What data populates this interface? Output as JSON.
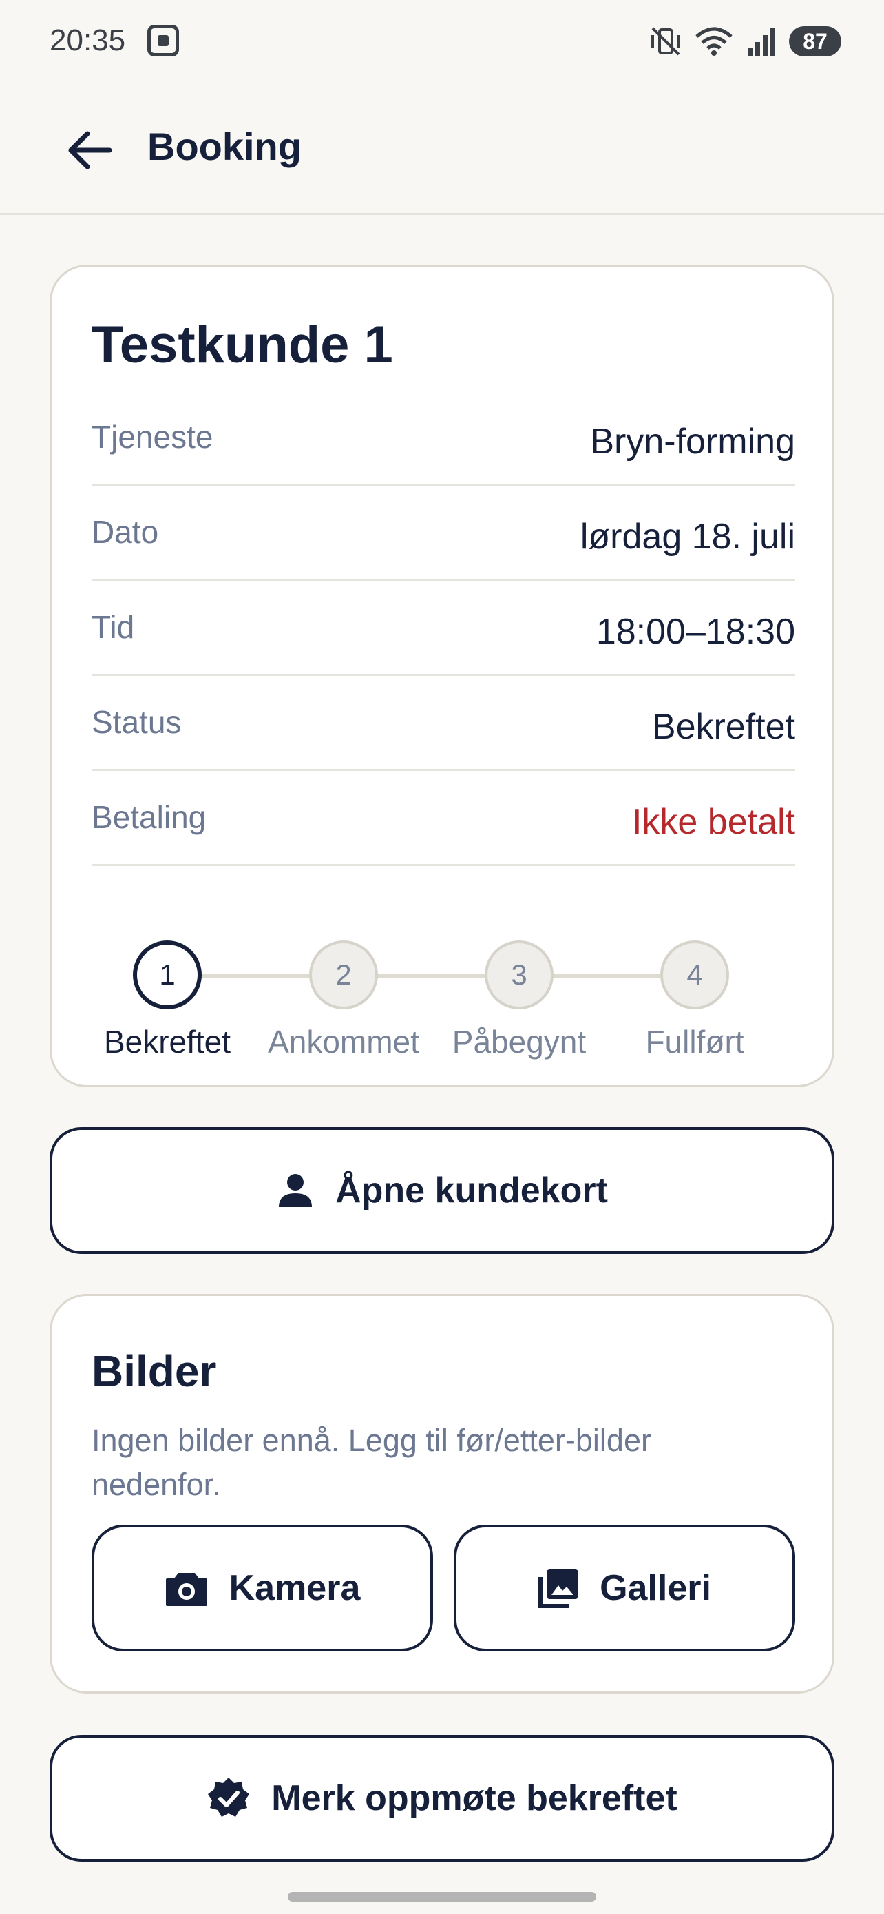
{
  "status_bar": {
    "time": "20:35",
    "battery": "87",
    "icons": [
      "screen-capture-icon",
      "mute-vibrate-icon",
      "wifi-icon",
      "signal-icon",
      "battery-icon"
    ]
  },
  "app_bar": {
    "title": "Booking",
    "back_icon": "arrow-left-icon"
  },
  "booking": {
    "customer_name": "Testkunde 1",
    "details": [
      {
        "label": "Tjeneste",
        "value": "Bryn-forming"
      },
      {
        "label": "Dato",
        "value": "lørdag 18. juli"
      },
      {
        "label": "Tid",
        "value": "18:00–18:30"
      },
      {
        "label": "Status",
        "value": "Bekreftet"
      },
      {
        "label": "Betaling",
        "value": "Ikke betalt"
      }
    ],
    "steps": [
      {
        "number": "1",
        "label": "Bekreftet"
      },
      {
        "number": "2",
        "label": "Ankommet"
      },
      {
        "number": "3",
        "label": "Påbegynt"
      },
      {
        "number": "4",
        "label": "Fullført"
      }
    ]
  },
  "actions": {
    "customer_card_label": "Åpne kundekort",
    "confirm_attendance_label": "Merk oppmøte bekreftet"
  },
  "photos": {
    "title": "Bilder",
    "empty_text": "Ingen bilder ennå. Legg til før/etter-bilder nedenfor.",
    "camera_label": "Kamera",
    "gallery_label": "Galleri"
  },
  "colors": {
    "background": "#f8f7f3",
    "text": "#16203a",
    "muted": "#6c7891",
    "unpaid": "#b5282c",
    "card_border": "#dcd8cf"
  }
}
